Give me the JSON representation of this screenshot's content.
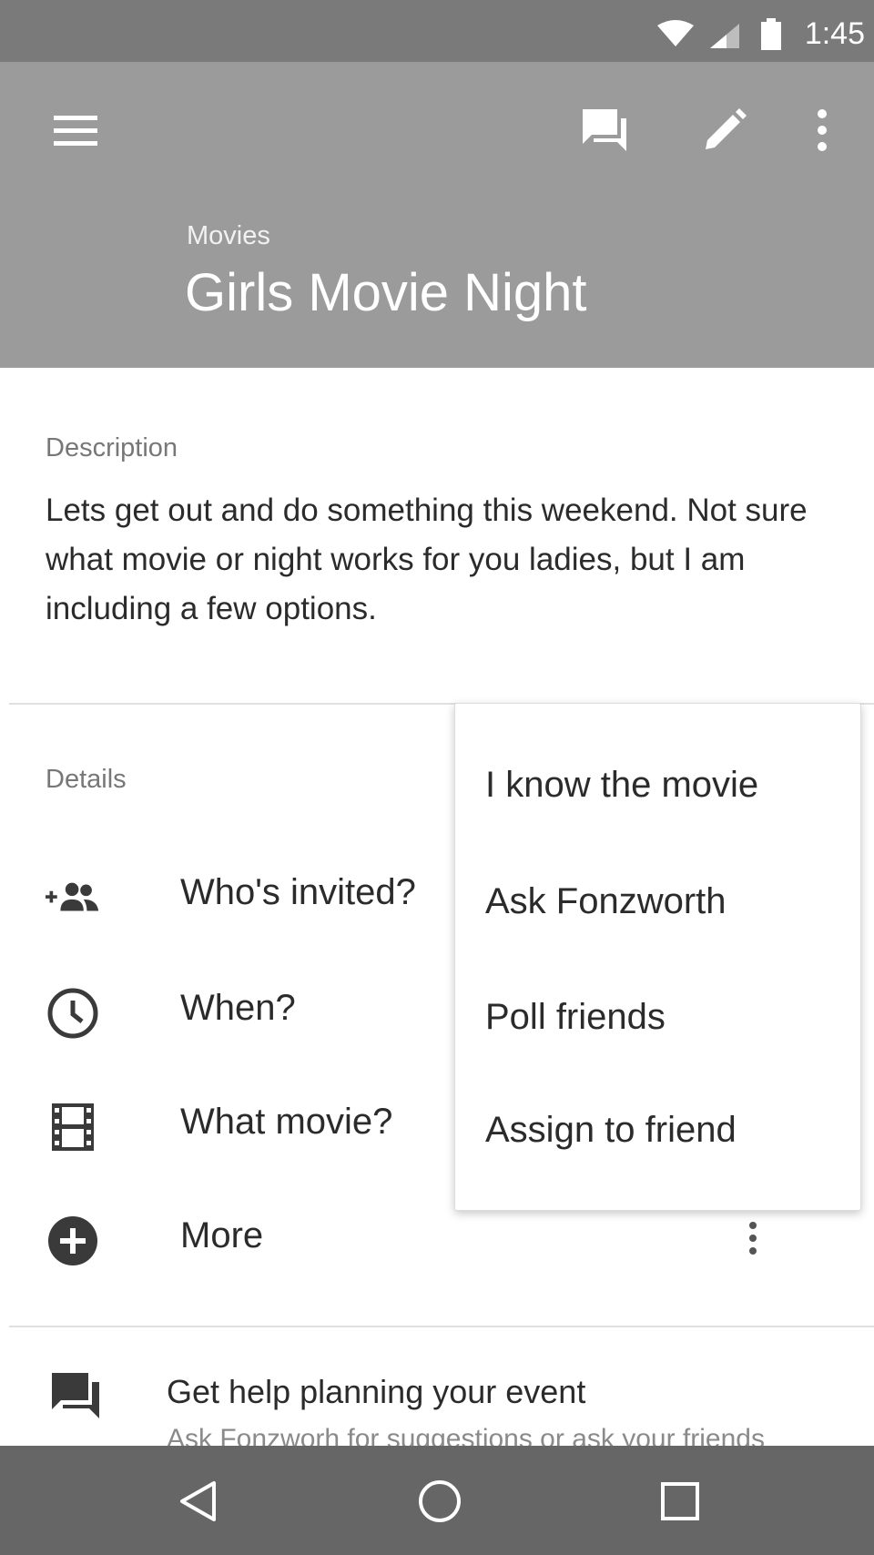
{
  "status_bar": {
    "time": "1:45",
    "icons": [
      "wifi-icon",
      "cell-signal-icon",
      "battery-icon"
    ]
  },
  "app_bar": {
    "category": "Movies",
    "title": "Girls Movie Night",
    "icons": [
      "menu-icon",
      "chat-icon",
      "edit-icon",
      "overflow-menu-icon"
    ]
  },
  "description": {
    "label": "Description",
    "text": "Lets get out and do something this weekend. Not sure what movie or night works for you ladies, but I am including a few options."
  },
  "details": {
    "label": "Details",
    "rows": [
      {
        "label": "Who's invited?",
        "icon": "add-people-icon"
      },
      {
        "label": "When?",
        "icon": "clock-icon"
      },
      {
        "label": "What movie?",
        "icon": "film-icon"
      },
      {
        "label": "More",
        "icon": "add-circle-icon"
      }
    ]
  },
  "popup_menu": {
    "items": [
      "I know the movie",
      "Ask Fonzworth",
      "Poll friends",
      "Assign to friend"
    ]
  },
  "help_card": {
    "icon": "chat-icon",
    "title": "Get help planning your event",
    "subtitle": "Ask Fonzworh for suggestions or ask your friends"
  },
  "nav_bar": {
    "icons": [
      "back-icon",
      "home-icon",
      "recents-icon"
    ]
  },
  "colors": {
    "status_bar": "#7a7a7a",
    "app_bar": "#9b9b9b",
    "nav_bar": "#666666"
  }
}
